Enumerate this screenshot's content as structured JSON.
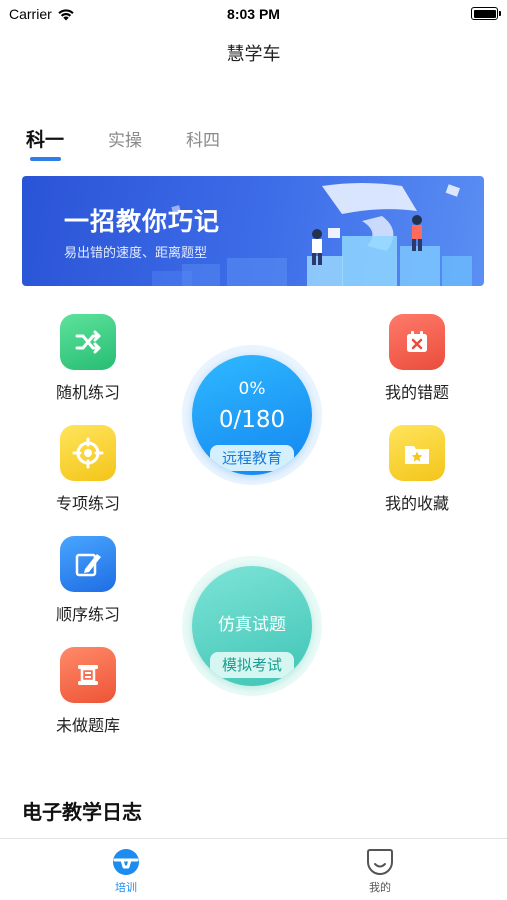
{
  "status_bar": {
    "carrier": "Carrier",
    "time": "8:03 PM"
  },
  "nav": {
    "title": "慧学车"
  },
  "tabs": [
    {
      "label": "科一",
      "active": true
    },
    {
      "label": "实操",
      "active": false
    },
    {
      "label": "科四",
      "active": false
    }
  ],
  "banner": {
    "title": "一招教你巧记",
    "subtitle": "易出错的速度、距离题型"
  },
  "features_left": [
    {
      "label": "随机练习",
      "icon": "shuffle-icon",
      "color": "#2fc47f"
    },
    {
      "label": "专项练习",
      "icon": "target-icon",
      "color": "#f5ca1f"
    },
    {
      "label": "顺序练习",
      "icon": "pencil-icon",
      "color": "#2a7ff0"
    },
    {
      "label": "未做题库",
      "icon": "scroll-icon",
      "color": "#f0603f"
    }
  ],
  "features_right": [
    {
      "label": "我的错题",
      "icon": "calendar-x-icon",
      "color": "#ef5443"
    },
    {
      "label": "我的收藏",
      "icon": "star-folder-icon",
      "color": "#f5ca1f"
    }
  ],
  "progress": {
    "percent_text": "0%",
    "count_text": "0/180",
    "percent": 0,
    "button": "远程教育"
  },
  "exam": {
    "title": "仿真试题",
    "button": "模拟考试"
  },
  "section": {
    "title": "电子教学日志"
  },
  "tab_bar": [
    {
      "label": "培训",
      "icon": "steering-wheel-icon",
      "active": true
    },
    {
      "label": "我的",
      "icon": "smiley-icon",
      "active": false
    }
  ],
  "colors": {
    "accent": "#1c8cf0",
    "banner": "#2f5ee0"
  }
}
